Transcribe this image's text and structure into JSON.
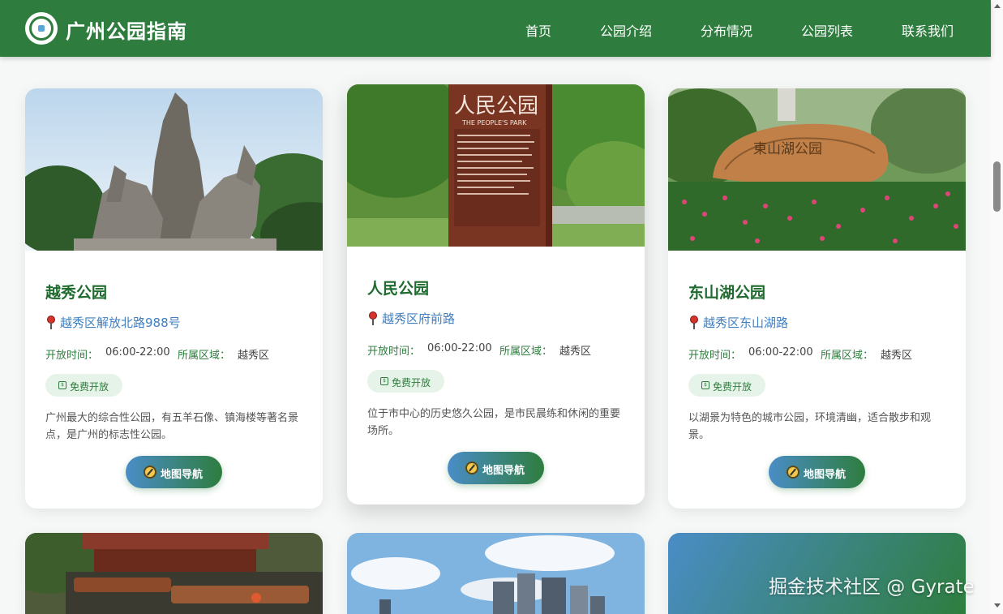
{
  "header": {
    "brand": "广州公园指南",
    "nav": [
      "首页",
      "公园介绍",
      "分布情况",
      "公园列表",
      "联系我们"
    ]
  },
  "labels": {
    "hours": "开放时间：",
    "district": "所属区域：",
    "nav_button": "地图导航"
  },
  "parks": [
    {
      "name": "越秀公园",
      "address": "越秀区解放北路988号",
      "hours": "06:00-22:00",
      "district": "越秀区",
      "badge": "免费开放",
      "description": "广州最大的综合性公园，有五羊石像、镇海楼等著名景点，是广州的标志性公园。"
    },
    {
      "name": "人民公园",
      "address": "越秀区府前路",
      "hours": "06:00-22:00",
      "district": "越秀区",
      "badge": "免费开放",
      "description": "位于市中心的历史悠久公园，是市民晨练和休闲的重要场所。",
      "sign_text": "人民公园",
      "sign_subtext": "THE PEOPLE'S PARK"
    },
    {
      "name": "东山湖公园",
      "address": "越秀区东山湖路",
      "hours": "06:00-22:00",
      "district": "越秀区",
      "badge": "免费开放",
      "description": "以湖景为特色的城市公园，环境清幽，适合散步和观景。",
      "rock_text": "東山湖公园"
    }
  ],
  "watermark": "掘金技术社区 @ Gyrate",
  "colors": {
    "primary": "#2e7d3e",
    "link": "#3f7fc0",
    "badge_bg": "#e6f3e8"
  }
}
